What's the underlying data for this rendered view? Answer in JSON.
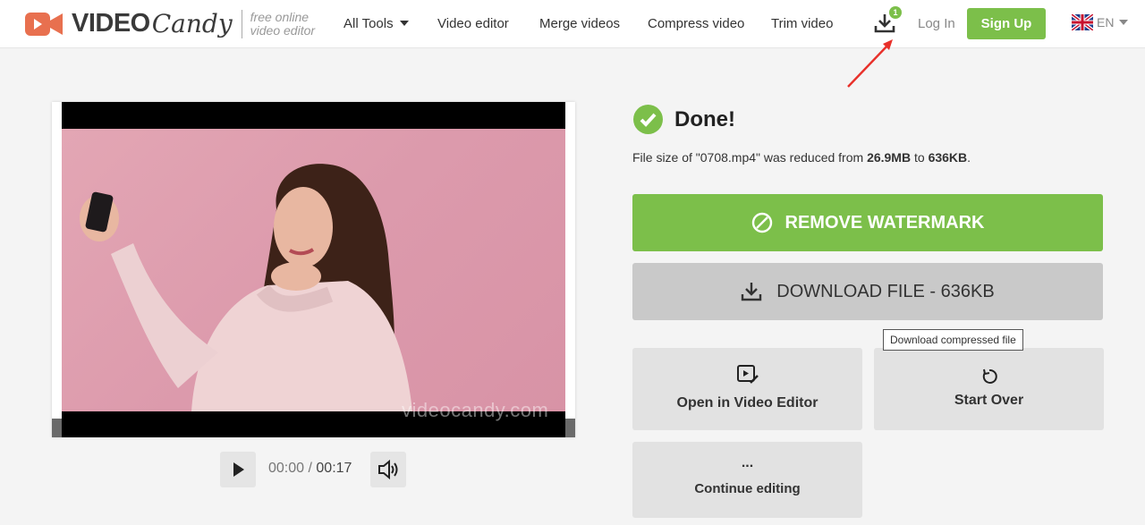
{
  "brand": {
    "name_part1": "VIDEO",
    "name_part2": "Candy",
    "tagline_line1": "free online",
    "tagline_line2": "video editor",
    "accent": "#7cbf4a",
    "logo_color": "#e8704f"
  },
  "nav": {
    "items": [
      {
        "label": "All Tools",
        "has_dropdown": true
      },
      {
        "label": "Video editor"
      },
      {
        "label": "Merge videos"
      },
      {
        "label": "Compress video"
      },
      {
        "label": "Trim video"
      }
    ],
    "downloads_badge": "1",
    "login": "Log In",
    "signup": "Sign Up",
    "language": "EN",
    "language_icon": "uk-flag-icon"
  },
  "player": {
    "watermark": "videocandy.com",
    "current_time": "00:00",
    "separator": "/",
    "duration": "00:17",
    "play_icon": "play-icon",
    "volume_icon": "volume-icon"
  },
  "result": {
    "status": "Done!",
    "status_icon": "check-circle-icon",
    "info_prefix": "File size of \"0708.mp4\" was reduced from ",
    "original_size": "26.9MB",
    "info_mid": " to ",
    "new_size": "636KB",
    "info_suffix": "."
  },
  "actions": {
    "remove_watermark": "REMOVE WATERMARK",
    "download": "DOWNLOAD FILE - 636KB",
    "download_tooltip": "Download compressed file",
    "open_editor": "Open in Video Editor",
    "start_over": "Start Over",
    "continue_dots": "...",
    "continue_editing": "Continue editing"
  }
}
